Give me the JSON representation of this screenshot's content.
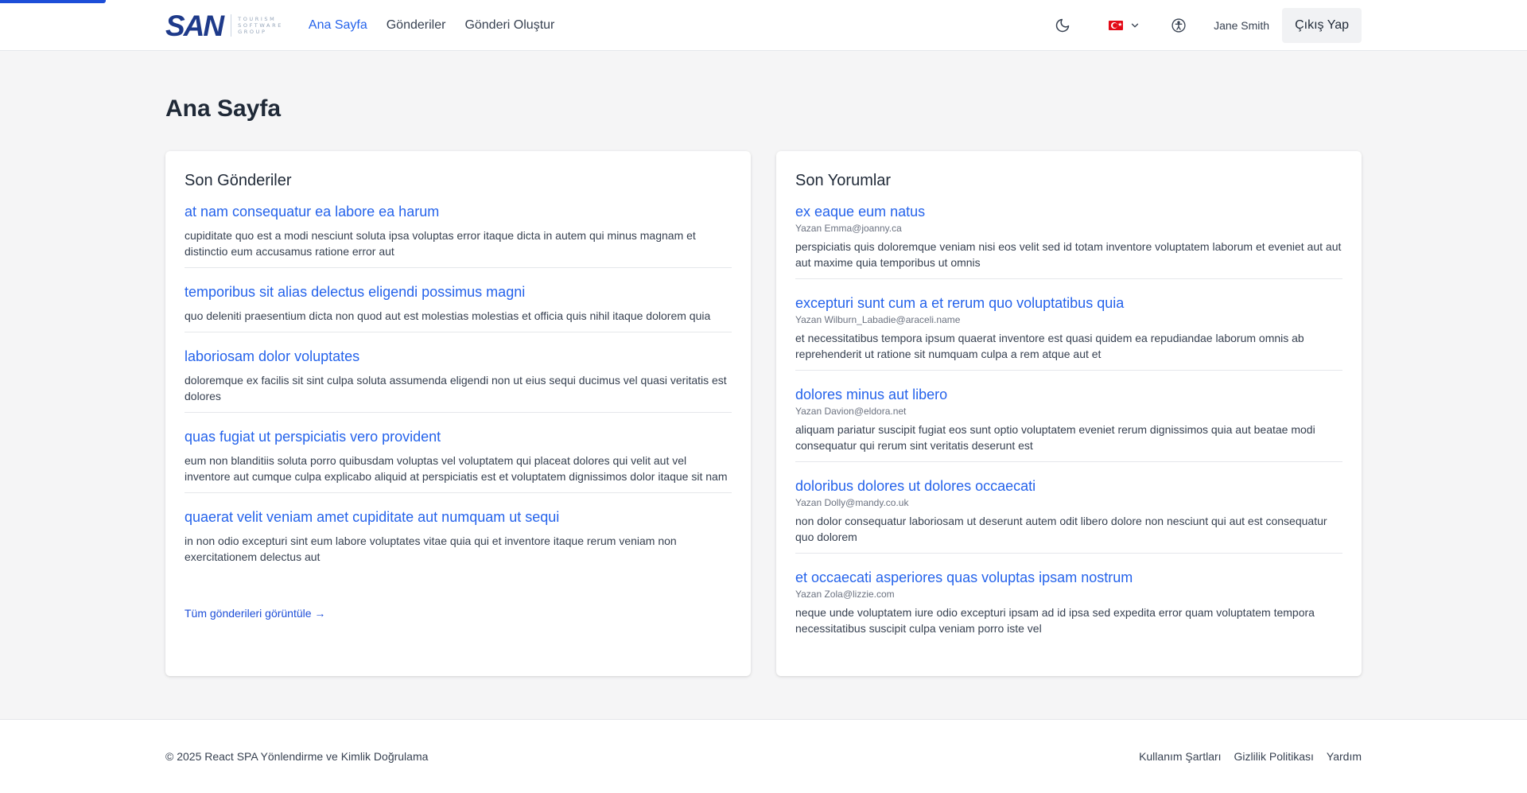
{
  "brand": {
    "logo_text": "SAN",
    "tagline": [
      "TOURISM",
      "SOFTWARE",
      "GROUP"
    ]
  },
  "nav": {
    "links": [
      {
        "label": "Ana Sayfa",
        "active": true
      },
      {
        "label": "Gönderiler",
        "active": false
      },
      {
        "label": "Gönderi Oluştur",
        "active": false
      }
    ],
    "theme_icon": "moon-icon",
    "language_flag": "turkey-flag",
    "accessibility_icon": "accessibility-icon",
    "user_name": "Jane Smith",
    "logout_label": "Çıkış Yap"
  },
  "page": {
    "title": "Ana Sayfa"
  },
  "recent_posts": {
    "title": "Son Gönderiler",
    "items": [
      {
        "title": "at nam consequatur ea labore ea harum",
        "body": "cupiditate quo est a modi nesciunt soluta ipsa voluptas error itaque dicta in autem qui minus magnam et distinctio eum accusamus ratione error aut"
      },
      {
        "title": "temporibus sit alias delectus eligendi possimus magni",
        "body": "quo deleniti praesentium dicta non quod aut est molestias molestias et officia quis nihil itaque dolorem quia"
      },
      {
        "title": "laboriosam dolor voluptates",
        "body": "doloremque ex facilis sit sint culpa soluta assumenda eligendi non ut eius sequi ducimus vel quasi veritatis est dolores"
      },
      {
        "title": "quas fugiat ut perspiciatis vero provident",
        "body": "eum non blanditiis soluta porro quibusdam voluptas vel voluptatem qui placeat dolores qui velit aut vel inventore aut cumque culpa explicabo aliquid at perspiciatis est et voluptatem dignissimos dolor itaque sit nam"
      },
      {
        "title": "quaerat velit veniam amet cupiditate aut numquam ut sequi",
        "body": "in non odio excepturi sint eum labore voluptates vitae quia qui et inventore itaque rerum veniam non exercitationem delectus aut"
      }
    ],
    "view_all_label": "Tüm gönderileri görüntüle →"
  },
  "recent_comments": {
    "title": "Son Yorumlar",
    "items": [
      {
        "title": "ex eaque eum natus",
        "author": "Yazan Emma@joanny.ca",
        "body": "perspiciatis quis doloremque veniam nisi eos velit sed id totam inventore voluptatem laborum et eveniet aut aut aut maxime quia temporibus ut omnis"
      },
      {
        "title": "excepturi sunt cum a et rerum quo voluptatibus quia",
        "author": "Yazan Wilburn_Labadie@araceli.name",
        "body": "et necessitatibus tempora ipsum quaerat inventore est quasi quidem ea repudiandae laborum omnis ab reprehenderit ut ratione sit numquam culpa a rem atque aut et"
      },
      {
        "title": "dolores minus aut libero",
        "author": "Yazan Davion@eldora.net",
        "body": "aliquam pariatur suscipit fugiat eos sunt optio voluptatem eveniet rerum dignissimos quia aut beatae modi consequatur qui rerum sint veritatis deserunt est"
      },
      {
        "title": "doloribus dolores ut dolores occaecati",
        "author": "Yazan Dolly@mandy.co.uk",
        "body": "non dolor consequatur laboriosam ut deserunt autem odit libero dolore non nesciunt qui aut est consequatur quo dolorem"
      },
      {
        "title": "et occaecati asperiores quas voluptas ipsam nostrum",
        "author": "Yazan Zola@lizzie.com",
        "body": "neque unde voluptatem iure odio excepturi ipsam ad id ipsa sed expedita error quam voluptatem tempora necessitatibus suscipit culpa veniam porro iste vel"
      }
    ]
  },
  "footer": {
    "copyright": "© 2025 React SPA Yönlendirme ve Kimlik Doğrulama",
    "links": [
      "Kullanım Şartları",
      "Gizlilik Politikası",
      "Yardım"
    ]
  },
  "colors": {
    "accent": "#2563eb",
    "background": "#f5f5f6",
    "card": "#ffffff",
    "brand": "#1e3a8a"
  }
}
